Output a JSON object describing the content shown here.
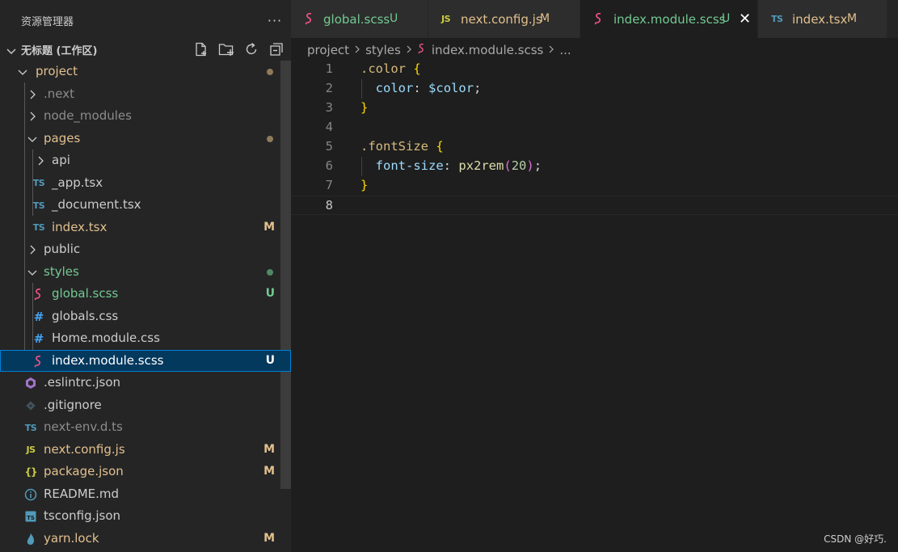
{
  "explorer": {
    "title": "资源管理器",
    "more": "···",
    "workspace_title": "无标题 (工作区)",
    "actions": [
      "new-file-icon",
      "new-folder-icon",
      "refresh-icon",
      "collapse-all-icon"
    ]
  },
  "tree": [
    {
      "label": "project",
      "badge": "",
      "status": "modified-dot"
    },
    {
      "label": ".next",
      "badge": "",
      "status": ""
    },
    {
      "label": "node_modules",
      "badge": "",
      "status": ""
    },
    {
      "label": "pages",
      "badge": "",
      "status": "modified-dot"
    },
    {
      "label": "api",
      "badge": "",
      "status": ""
    },
    {
      "label": "_app.tsx",
      "icon": "TS",
      "badge": "",
      "status": ""
    },
    {
      "label": "_document.tsx",
      "icon": "TS",
      "badge": "",
      "status": ""
    },
    {
      "label": "index.tsx",
      "icon": "TS",
      "badge": "M",
      "status": "modified"
    },
    {
      "label": "public",
      "badge": "",
      "status": ""
    },
    {
      "label": "styles",
      "badge": "",
      "status": "untracked-dot"
    },
    {
      "label": "global.scss",
      "badge": "U",
      "status": "untracked"
    },
    {
      "label": "globals.css",
      "icon": "#",
      "badge": "",
      "status": ""
    },
    {
      "label": "Home.module.css",
      "icon": "#",
      "badge": "",
      "status": ""
    },
    {
      "label": "index.module.scss",
      "badge": "U",
      "status": "selected"
    },
    {
      "label": ".eslintrc.json",
      "badge": "",
      "status": ""
    },
    {
      "label": ".gitignore",
      "badge": "",
      "status": ""
    },
    {
      "label": "next-env.d.ts",
      "icon": "TS",
      "badge": "",
      "status": ""
    },
    {
      "label": "next.config.js",
      "icon": "JS",
      "badge": "M",
      "status": "modified"
    },
    {
      "label": "package.json",
      "icon": "{}",
      "badge": "M",
      "status": "modified"
    },
    {
      "label": "README.md",
      "badge": "",
      "status": ""
    },
    {
      "label": "tsconfig.json",
      "badge": "",
      "status": ""
    },
    {
      "label": "yarn.lock",
      "badge": "M",
      "status": "modified"
    }
  ],
  "tabs": [
    {
      "name": "global.scss",
      "status": "U"
    },
    {
      "name": "next.config.js",
      "icon": "JS",
      "status": "M"
    },
    {
      "name": "index.module.scss",
      "status": "U",
      "close": "✕"
    },
    {
      "name": "index.tsx",
      "icon": "TS",
      "status": "M"
    }
  ],
  "breadcrumb": {
    "parts": [
      "project",
      "styles",
      "index.module.scss",
      "..."
    ]
  },
  "editor": {
    "line_numbers": [
      "1",
      "2",
      "3",
      "4",
      "5",
      "6",
      "7",
      "8"
    ],
    "current_line": 8,
    "code": {
      "l1_sel": ".color",
      "l1_br": "{",
      "l2_prop": "color",
      "l2_colon": ":",
      "l2_val": "$color",
      "l2_semi": ";",
      "l3_br": "}",
      "l5_sel": ".fontSize",
      "l5_br": "{",
      "l6_prop": "font-size",
      "l6_colon": ":",
      "l6_fn": "px2rem",
      "l6_open": "(",
      "l6_num": "20",
      "l6_close": ")",
      "l6_semi": ";",
      "l7_br": "}"
    }
  },
  "watermark": "CSDN @好巧.",
  "colors": {
    "modified": "#e2c08d",
    "untracked": "#73c991",
    "selection": "#04395e",
    "scss_icon": "#f55385"
  }
}
